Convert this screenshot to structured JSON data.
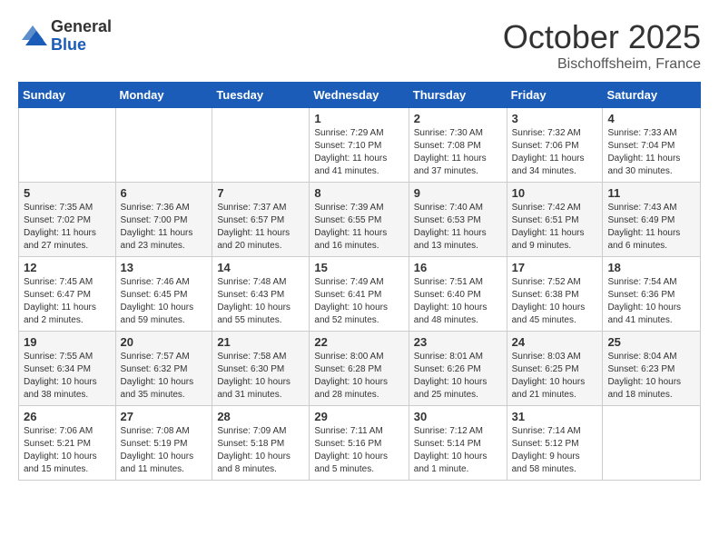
{
  "logo": {
    "general": "General",
    "blue": "Blue"
  },
  "title": {
    "month": "October 2025",
    "location": "Bischoffsheim, France"
  },
  "headers": [
    "Sunday",
    "Monday",
    "Tuesday",
    "Wednesday",
    "Thursday",
    "Friday",
    "Saturday"
  ],
  "weeks": [
    [
      {
        "day": "",
        "info": ""
      },
      {
        "day": "",
        "info": ""
      },
      {
        "day": "",
        "info": ""
      },
      {
        "day": "1",
        "info": "Sunrise: 7:29 AM\nSunset: 7:10 PM\nDaylight: 11 hours\nand 41 minutes."
      },
      {
        "day": "2",
        "info": "Sunrise: 7:30 AM\nSunset: 7:08 PM\nDaylight: 11 hours\nand 37 minutes."
      },
      {
        "day": "3",
        "info": "Sunrise: 7:32 AM\nSunset: 7:06 PM\nDaylight: 11 hours\nand 34 minutes."
      },
      {
        "day": "4",
        "info": "Sunrise: 7:33 AM\nSunset: 7:04 PM\nDaylight: 11 hours\nand 30 minutes."
      }
    ],
    [
      {
        "day": "5",
        "info": "Sunrise: 7:35 AM\nSunset: 7:02 PM\nDaylight: 11 hours\nand 27 minutes."
      },
      {
        "day": "6",
        "info": "Sunrise: 7:36 AM\nSunset: 7:00 PM\nDaylight: 11 hours\nand 23 minutes."
      },
      {
        "day": "7",
        "info": "Sunrise: 7:37 AM\nSunset: 6:57 PM\nDaylight: 11 hours\nand 20 minutes."
      },
      {
        "day": "8",
        "info": "Sunrise: 7:39 AM\nSunset: 6:55 PM\nDaylight: 11 hours\nand 16 minutes."
      },
      {
        "day": "9",
        "info": "Sunrise: 7:40 AM\nSunset: 6:53 PM\nDaylight: 11 hours\nand 13 minutes."
      },
      {
        "day": "10",
        "info": "Sunrise: 7:42 AM\nSunset: 6:51 PM\nDaylight: 11 hours\nand 9 minutes."
      },
      {
        "day": "11",
        "info": "Sunrise: 7:43 AM\nSunset: 6:49 PM\nDaylight: 11 hours\nand 6 minutes."
      }
    ],
    [
      {
        "day": "12",
        "info": "Sunrise: 7:45 AM\nSunset: 6:47 PM\nDaylight: 11 hours\nand 2 minutes."
      },
      {
        "day": "13",
        "info": "Sunrise: 7:46 AM\nSunset: 6:45 PM\nDaylight: 10 hours\nand 59 minutes."
      },
      {
        "day": "14",
        "info": "Sunrise: 7:48 AM\nSunset: 6:43 PM\nDaylight: 10 hours\nand 55 minutes."
      },
      {
        "day": "15",
        "info": "Sunrise: 7:49 AM\nSunset: 6:41 PM\nDaylight: 10 hours\nand 52 minutes."
      },
      {
        "day": "16",
        "info": "Sunrise: 7:51 AM\nSunset: 6:40 PM\nDaylight: 10 hours\nand 48 minutes."
      },
      {
        "day": "17",
        "info": "Sunrise: 7:52 AM\nSunset: 6:38 PM\nDaylight: 10 hours\nand 45 minutes."
      },
      {
        "day": "18",
        "info": "Sunrise: 7:54 AM\nSunset: 6:36 PM\nDaylight: 10 hours\nand 41 minutes."
      }
    ],
    [
      {
        "day": "19",
        "info": "Sunrise: 7:55 AM\nSunset: 6:34 PM\nDaylight: 10 hours\nand 38 minutes."
      },
      {
        "day": "20",
        "info": "Sunrise: 7:57 AM\nSunset: 6:32 PM\nDaylight: 10 hours\nand 35 minutes."
      },
      {
        "day": "21",
        "info": "Sunrise: 7:58 AM\nSunset: 6:30 PM\nDaylight: 10 hours\nand 31 minutes."
      },
      {
        "day": "22",
        "info": "Sunrise: 8:00 AM\nSunset: 6:28 PM\nDaylight: 10 hours\nand 28 minutes."
      },
      {
        "day": "23",
        "info": "Sunrise: 8:01 AM\nSunset: 6:26 PM\nDaylight: 10 hours\nand 25 minutes."
      },
      {
        "day": "24",
        "info": "Sunrise: 8:03 AM\nSunset: 6:25 PM\nDaylight: 10 hours\nand 21 minutes."
      },
      {
        "day": "25",
        "info": "Sunrise: 8:04 AM\nSunset: 6:23 PM\nDaylight: 10 hours\nand 18 minutes."
      }
    ],
    [
      {
        "day": "26",
        "info": "Sunrise: 7:06 AM\nSunset: 5:21 PM\nDaylight: 10 hours\nand 15 minutes."
      },
      {
        "day": "27",
        "info": "Sunrise: 7:08 AM\nSunset: 5:19 PM\nDaylight: 10 hours\nand 11 minutes."
      },
      {
        "day": "28",
        "info": "Sunrise: 7:09 AM\nSunset: 5:18 PM\nDaylight: 10 hours\nand 8 minutes."
      },
      {
        "day": "29",
        "info": "Sunrise: 7:11 AM\nSunset: 5:16 PM\nDaylight: 10 hours\nand 5 minutes."
      },
      {
        "day": "30",
        "info": "Sunrise: 7:12 AM\nSunset: 5:14 PM\nDaylight: 10 hours\nand 1 minute."
      },
      {
        "day": "31",
        "info": "Sunrise: 7:14 AM\nSunset: 5:12 PM\nDaylight: 9 hours\nand 58 minutes."
      },
      {
        "day": "",
        "info": ""
      }
    ]
  ]
}
